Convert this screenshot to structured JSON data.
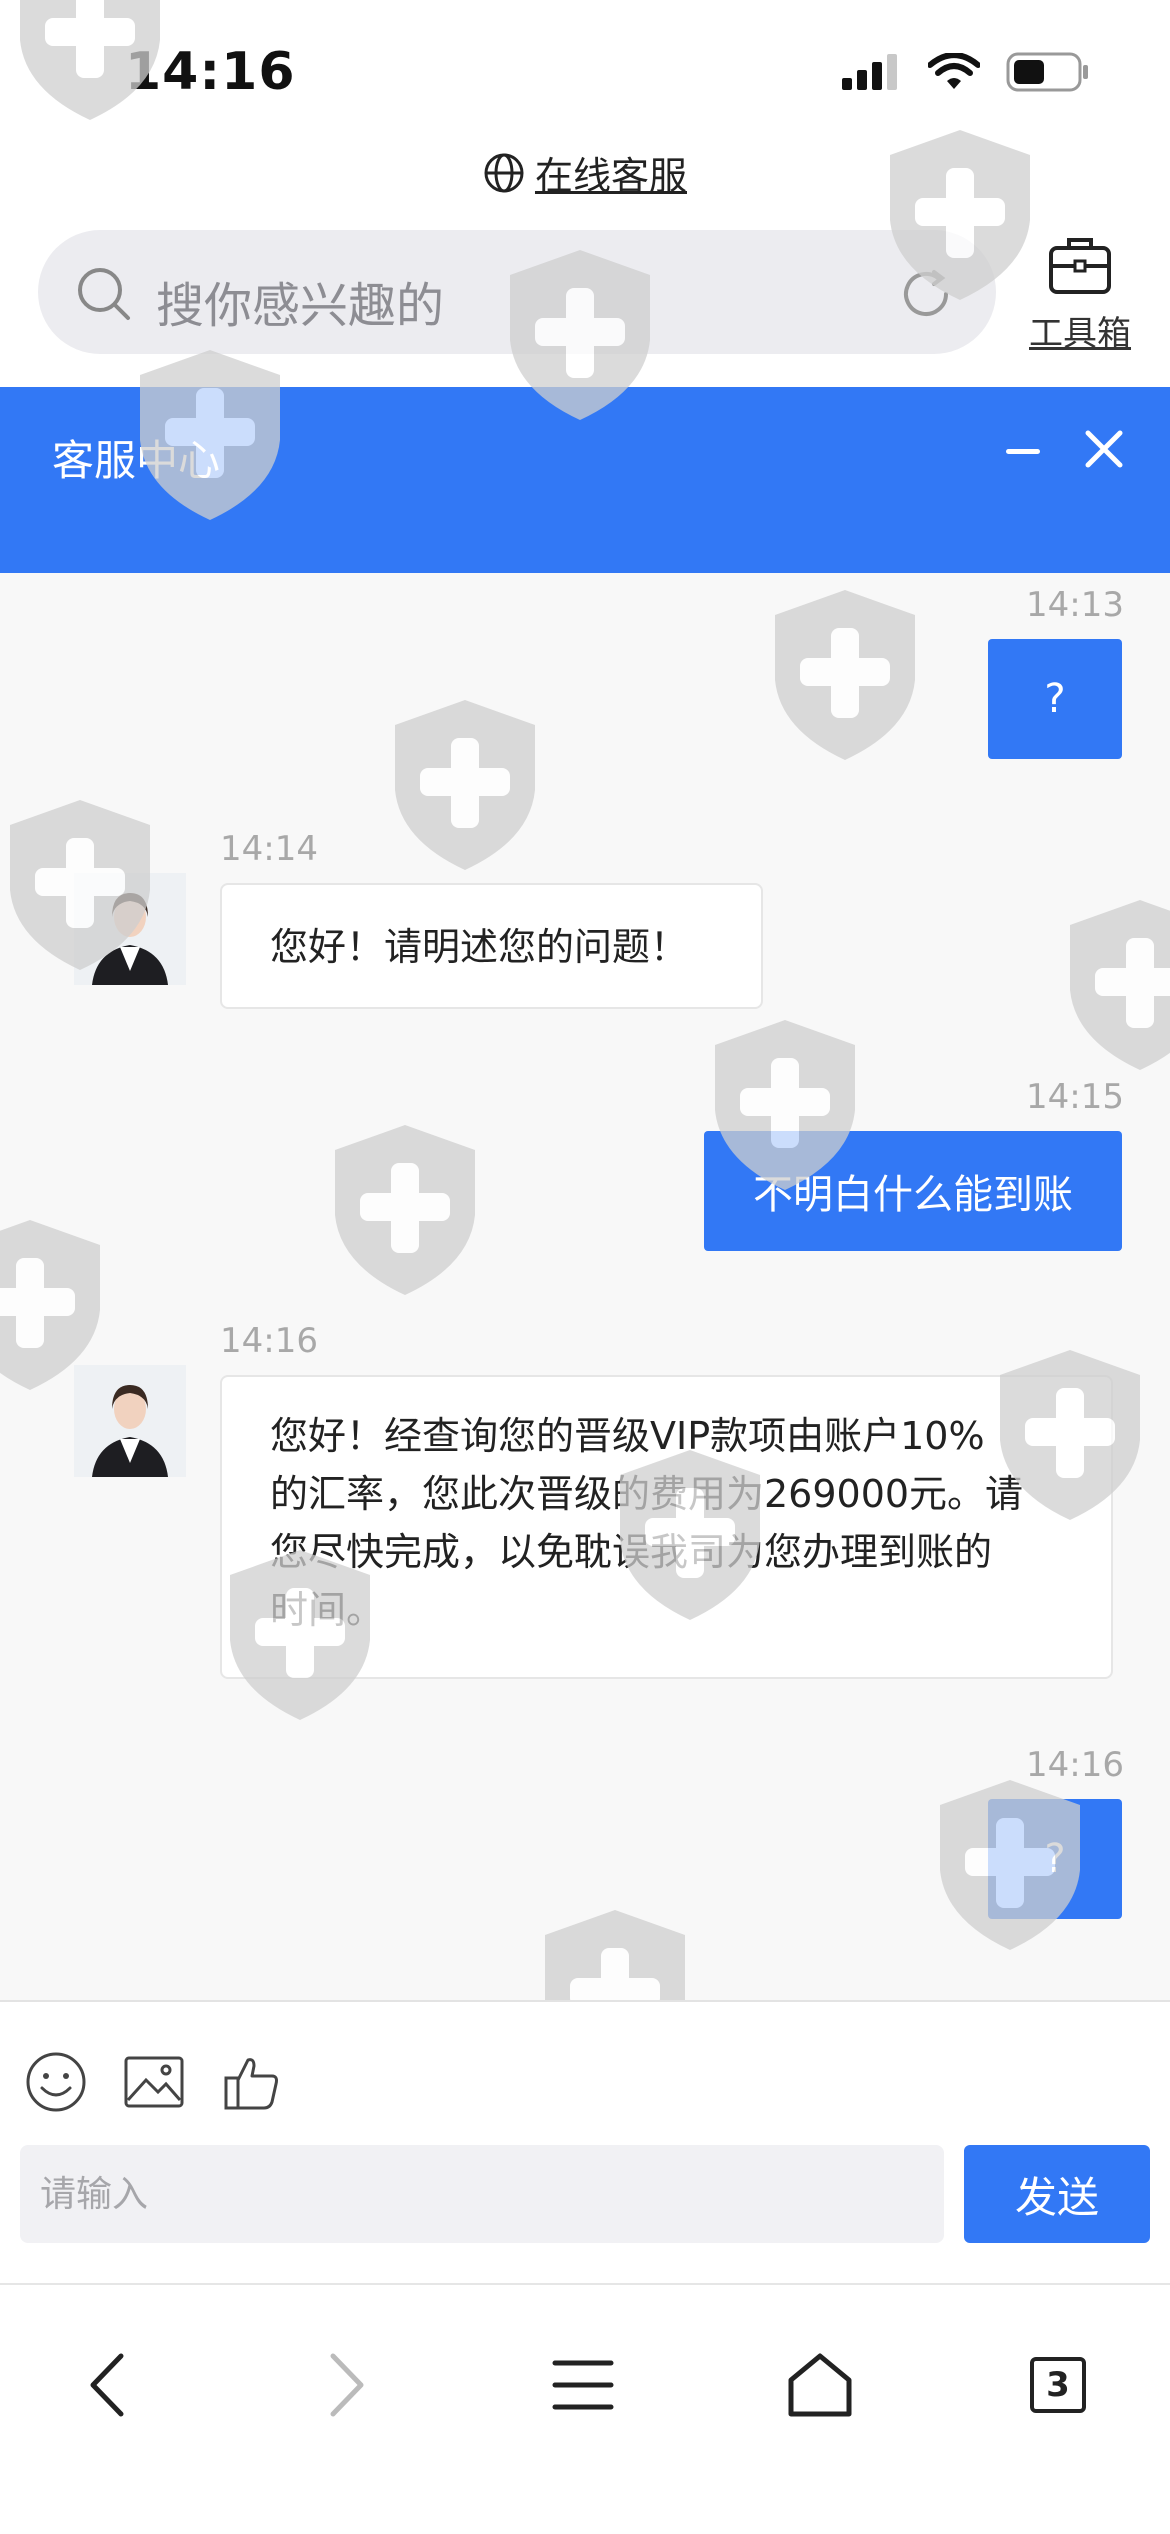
{
  "status_bar": {
    "time": "14:16"
  },
  "browser": {
    "url_label": "在线客服",
    "search_placeholder": "搜你感兴趣的",
    "toolbox_label": "工具箱"
  },
  "header": {
    "title": "客服中心"
  },
  "messages": [
    {
      "side": "right",
      "time": "14:13",
      "text": "?"
    },
    {
      "side": "left",
      "time": "14:14",
      "text": "您好！请明述您的问题！"
    },
    {
      "side": "right",
      "time": "14:15",
      "text": "不明白什么能到账"
    },
    {
      "side": "left",
      "time": "14:16",
      "lines": [
        "您好！经查询您的晋级VIP款项由账户10%",
        "的汇率，您此次晋级的费用为269000元。请",
        "您尽快完成，以免耽误我司为您办理到账的",
        "时间。"
      ]
    },
    {
      "side": "right",
      "time": "14:16",
      "text": "?"
    }
  ],
  "composer": {
    "placeholder": "请输入",
    "send_label": "发送"
  },
  "nav": {
    "tab_count": "3"
  },
  "colors": {
    "accent": "#3278f5",
    "chat_bg": "#f8f8f8"
  }
}
